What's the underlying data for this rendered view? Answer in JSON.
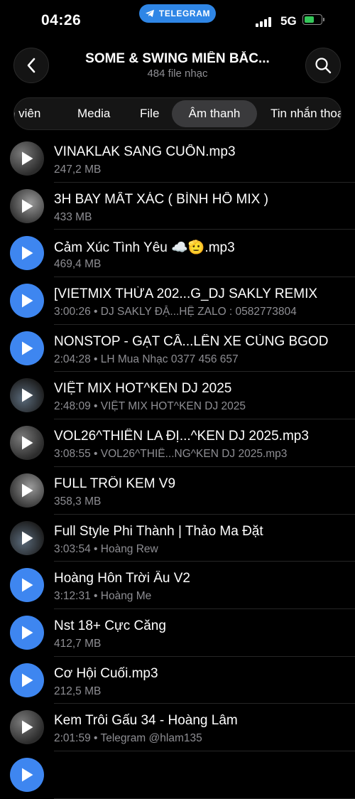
{
  "status_bar": {
    "time": "04:26",
    "network": "5G",
    "pill_label": "TELEGRAM"
  },
  "header": {
    "title": "SOME & SWING MIỀN BẮC...",
    "subtitle": "484 file nhạc"
  },
  "tabs": [
    {
      "label": "h viên"
    },
    {
      "label": "Media"
    },
    {
      "label": "File"
    },
    {
      "label": "Âm thanh",
      "active": true
    },
    {
      "label": "Tin nhắn thoại"
    }
  ],
  "items": [
    {
      "title": "VINAKLAK SANG CUỐN.mp3",
      "subtitle": "247,2 MB",
      "thumb": "image"
    },
    {
      "title": "3H BAY MẤT XÁC ( BÌNH HỒ MIX )",
      "subtitle": "433 MB",
      "thumb": "image"
    },
    {
      "title": "Cảm Xúc Tình Yêu ☁️🫡.mp3",
      "subtitle": "469,4 MB",
      "thumb": "blue"
    },
    {
      "title": "[VIETMIX THỪA 202...G_DJ SAKLY REMIX",
      "subtitle": "3:00:26 • DJ SAKLY ĐẶ...HỆ ZALO : 0582773804",
      "thumb": "blue"
    },
    {
      "title": "NONSTOP - GẠT CẦ...LÊN XE CÙNG BGOD",
      "subtitle": "2:04:28 • LH Mua Nhạc 0377 456 657",
      "thumb": "blue"
    },
    {
      "title": "VIỆT MIX HOT^KEN DJ 2025",
      "subtitle": "2:48:09 • VIỆT MIX HOT^KEN DJ 2025",
      "thumb": "image"
    },
    {
      "title": "VOL26^THIÊN LA ĐỊ...^KEN DJ 2025.mp3",
      "subtitle": "3:08:55 • VOL26^THIÊ...NG^KEN DJ 2025.mp3",
      "thumb": "image"
    },
    {
      "title": "FULL TRÔI KEM V9",
      "subtitle": "358,3 MB",
      "thumb": "image"
    },
    {
      "title": "Full Style Phi Thành | Thảo Ma Đặt",
      "subtitle": "3:03:54 • Hoàng Rew",
      "thumb": "image"
    },
    {
      "title": "Hoàng Hôn Trời Âu V2",
      "subtitle": "3:12:31 • Hoàng Me",
      "thumb": "blue"
    },
    {
      "title": "Nst 18+ Cực Căng",
      "subtitle": "412,7 MB",
      "thumb": "blue"
    },
    {
      "title": "Cơ Hội Cuối.mp3",
      "subtitle": "212,5 MB",
      "thumb": "blue"
    },
    {
      "title": "Kem Trôi Gấu 34 - Hoàng Lâm",
      "subtitle": "2:01:59 • Telegram @hlam135",
      "thumb": "image"
    },
    {
      "title": "",
      "subtitle": "",
      "thumb": "blue"
    }
  ],
  "colors": {
    "accent": "#3e86f0",
    "telegram_pill": "#2f86e6",
    "battery": "#34c759",
    "secondary_text": "#8e8e93"
  }
}
